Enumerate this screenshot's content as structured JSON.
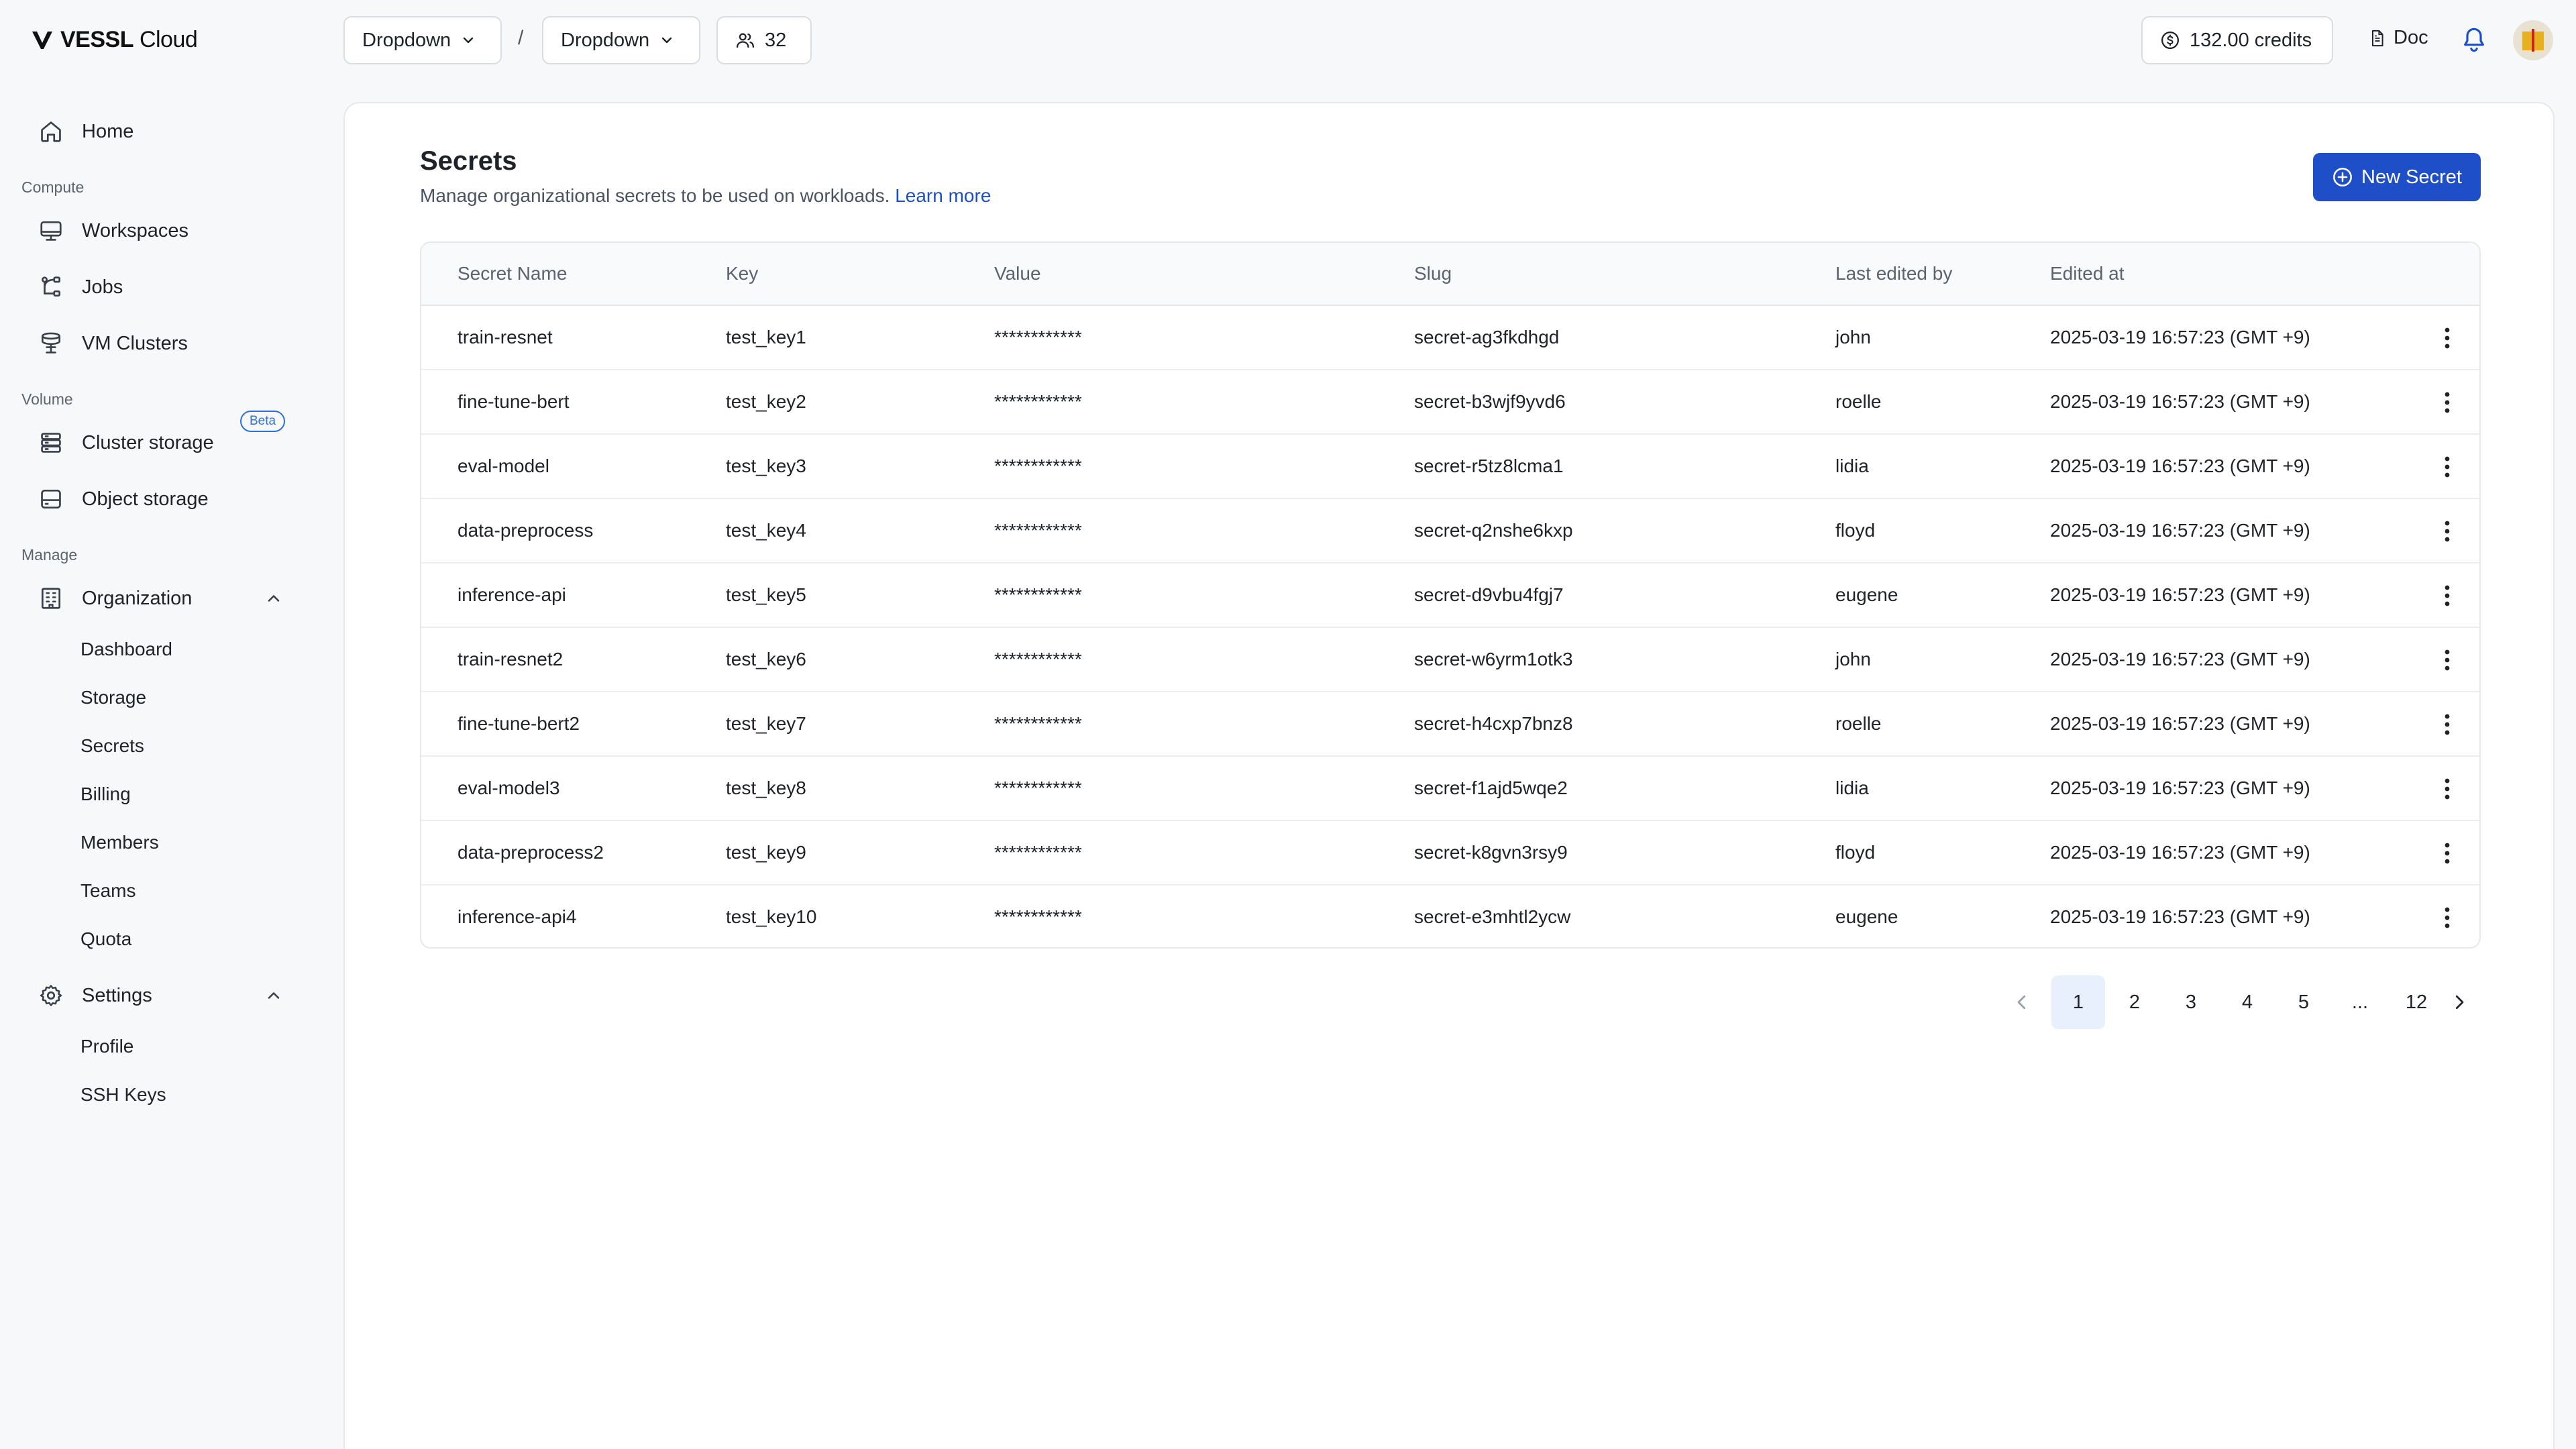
{
  "header": {
    "logo_text": "VESSL",
    "logo_suffix": "Cloud",
    "dropdown1": "Dropdown",
    "separator": "/",
    "dropdown2": "Dropdown",
    "member_count": "32",
    "credits": "132.00 credits",
    "doc_label": "Doc"
  },
  "sidebar": {
    "home": "Home",
    "compute_label": "Compute",
    "workspaces": "Workspaces",
    "jobs": "Jobs",
    "vm_clusters": "VM Clusters",
    "beta": "Beta",
    "volume_label": "Volume",
    "cluster_storage": "Cluster storage",
    "object_storage": "Object storage",
    "manage_label": "Manage",
    "organization": "Organization",
    "org_items": [
      "Dashboard",
      "Storage",
      "Secrets",
      "Billing",
      "Members",
      "Teams",
      "Quota"
    ],
    "settings": "Settings",
    "settings_items": [
      "Profile",
      "SSH Keys"
    ]
  },
  "main": {
    "title": "Secrets",
    "subtitle": "Manage organizational secrets to be used on workloads.",
    "learn_more": "Learn more",
    "new_button": "New Secret",
    "columns": [
      "Secret Name",
      "Key",
      "Value",
      "Slug",
      "Last edited by",
      "Edited at"
    ],
    "rows": [
      [
        "train-resnet",
        "test_key1",
        "************",
        "secret-ag3fkdhgd",
        "john",
        "2025-03-19 16:57:23 (GMT +9)"
      ],
      [
        "fine-tune-bert",
        "test_key2",
        "************",
        "secret-b3wjf9yvd6",
        "roelle",
        "2025-03-19 16:57:23 (GMT +9)"
      ],
      [
        "eval-model",
        "test_key3",
        "************",
        "secret-r5tz8lcma1",
        "lidia",
        "2025-03-19 16:57:23 (GMT +9)"
      ],
      [
        "data-preprocess",
        "test_key4",
        "************",
        "secret-q2nshe6kxp",
        "floyd",
        "2025-03-19 16:57:23 (GMT +9)"
      ],
      [
        "inference-api",
        "test_key5",
        "************",
        "secret-d9vbu4fgj7",
        "eugene",
        "2025-03-19 16:57:23 (GMT +9)"
      ],
      [
        "train-resnet2",
        "test_key6",
        "************",
        "secret-w6yrm1otk3",
        "john",
        "2025-03-19 16:57:23 (GMT +9)"
      ],
      [
        "fine-tune-bert2",
        "test_key7",
        "************",
        "secret-h4cxp7bnz8",
        "roelle",
        "2025-03-19 16:57:23 (GMT +9)"
      ],
      [
        "eval-model3",
        "test_key8",
        "************",
        "secret-f1ajd5wqe2",
        "lidia",
        "2025-03-19 16:57:23 (GMT +9)"
      ],
      [
        "data-preprocess2",
        "test_key9",
        "************",
        "secret-k8gvn3rsy9",
        "floyd",
        "2025-03-19 16:57:23 (GMT +9)"
      ],
      [
        "inference-api4",
        "test_key10",
        "************",
        "secret-e3mhtl2ycw",
        "eugene",
        "2025-03-19 16:57:23 (GMT +9)"
      ]
    ],
    "pagination": [
      "1",
      "2",
      "3",
      "4",
      "5",
      "...",
      "12"
    ],
    "active_page": "1"
  },
  "colors": {
    "accent": "#1e4fc9",
    "link": "#1d4fc4",
    "active_page_bg": "#e8f0fe"
  }
}
